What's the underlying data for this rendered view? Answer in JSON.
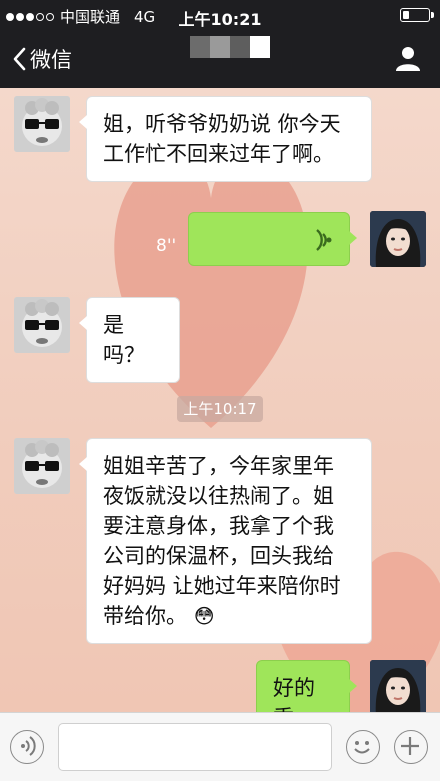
{
  "status_bar": {
    "carrier": "中国联通",
    "network": "4G",
    "time": "上午10:21",
    "signal_bars_filled": 3,
    "signal_bars_total": 5,
    "battery_level": 0.25
  },
  "nav": {
    "back_label": "微信",
    "back_icon": "chevron-left-icon",
    "profile_icon": "person-icon"
  },
  "messages": [
    {
      "side": "left",
      "type": "text",
      "text_lines": [
        "姐，听爷爷奶奶说 你今天",
        "工作忙不回来过年了啊。"
      ]
    },
    {
      "side": "right",
      "type": "voice",
      "duration": "8''",
      "icon": "voice-wave-icon"
    },
    {
      "side": "left",
      "type": "text",
      "text": "是吗？"
    },
    {
      "side": "center",
      "type": "timestamp",
      "text": "上午10:17"
    },
    {
      "side": "left",
      "type": "text",
      "text_lines": [
        "姐姐辛苦了，今年家里年",
        "夜饭就没以往热闹了。姐",
        "要注意身体，我拿了个我",
        "公司的保温杯，回头我给",
        "好妈妈 让她过年来陪你时",
        "带给你。"
      ],
      "emoji": "😳"
    },
    {
      "side": "right",
      "type": "text",
      "text": "好的乖"
    }
  ],
  "input_bar": {
    "voice_icon": "voice-icon",
    "emoji_icon": "smile-icon",
    "add_icon": "plus-icon",
    "value": ""
  },
  "colors": {
    "bar_bg": "#1e1e21",
    "sent_bubble": "#9fe55a",
    "received_bubble": "#ffffff"
  }
}
